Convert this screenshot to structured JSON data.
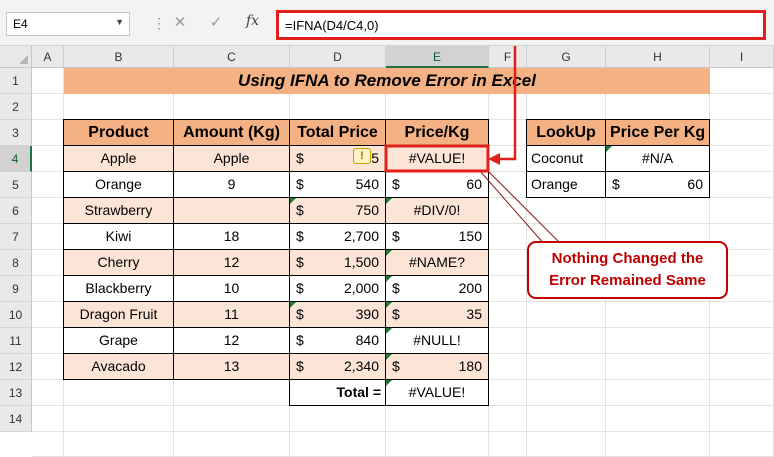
{
  "formula_bar": {
    "name_box": "E4",
    "formula": "=IFNA(D4/C4,0)",
    "cancel_icon": "✕",
    "enter_icon": "✓",
    "fx_label": "fx"
  },
  "columns": [
    "A",
    "B",
    "C",
    "D",
    "E",
    "F",
    "G",
    "H",
    "I"
  ],
  "rows": [
    "1",
    "2",
    "3",
    "4",
    "5",
    "6",
    "7",
    "8",
    "9",
    "10",
    "11",
    "12",
    "13",
    "14"
  ],
  "title": "Using IFNA to Remove Error in Excel",
  "table": {
    "headers": [
      "Product",
      "Amount (Kg)",
      "Total Price",
      "Price/Kg"
    ],
    "rows": [
      {
        "product": "Apple",
        "amount": "Apple",
        "total": "515",
        "price": "#VALUE!"
      },
      {
        "product": "Orange",
        "amount": "9",
        "total": "540",
        "price": "60"
      },
      {
        "product": "Strawberry",
        "amount": "",
        "total": "750",
        "price": "#DIV/0!"
      },
      {
        "product": "Kiwi",
        "amount": "18",
        "total": "2,700",
        "price": "150"
      },
      {
        "product": "Cherry",
        "amount": "12",
        "total": "1,500",
        "price": "#NAME?"
      },
      {
        "product": "Blackberry",
        "amount": "10",
        "total": "2,000",
        "price": "200"
      },
      {
        "product": "Dragon Fruit",
        "amount": "11",
        "total": "390",
        "price": "35"
      },
      {
        "product": "Grape",
        "amount": "12",
        "total": "840",
        "price": "#NULL!"
      },
      {
        "product": "Avacado",
        "amount": "13",
        "total": "2,340",
        "price": "180"
      }
    ],
    "total_label": "Total =",
    "total_value": "#VALUE!",
    "currency": "$"
  },
  "lookup": {
    "headers": [
      "LookUp",
      "Price Per Kg"
    ],
    "rows": [
      {
        "key": "Coconut",
        "value": "#N/A"
      },
      {
        "key": "Orange",
        "value": "60"
      }
    ]
  },
  "callout": {
    "line1": "Nothing Changed the",
    "line2": "Error Remained Same"
  },
  "colors": {
    "accent_red": "#e0211b",
    "header_fill": "#f4b183",
    "row_fill": "#fce4d6",
    "excel_green": "#217346"
  }
}
